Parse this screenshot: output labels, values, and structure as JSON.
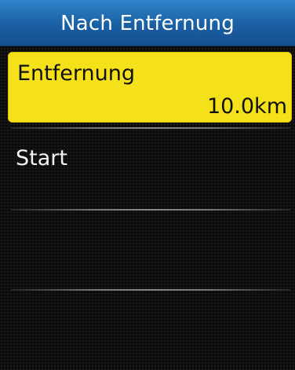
{
  "header": {
    "title": "Nach Entfernung"
  },
  "menu": {
    "items": [
      {
        "label": "Entfernung",
        "value": "10.0km",
        "selected": true
      },
      {
        "label": "Start",
        "selected": false
      }
    ]
  },
  "colors": {
    "header_blue": "#1a5fa4",
    "selection_yellow": "#f5e11a",
    "background": "#0b0b0b",
    "text_light": "#f2f2f2",
    "text_dark": "#111111"
  }
}
